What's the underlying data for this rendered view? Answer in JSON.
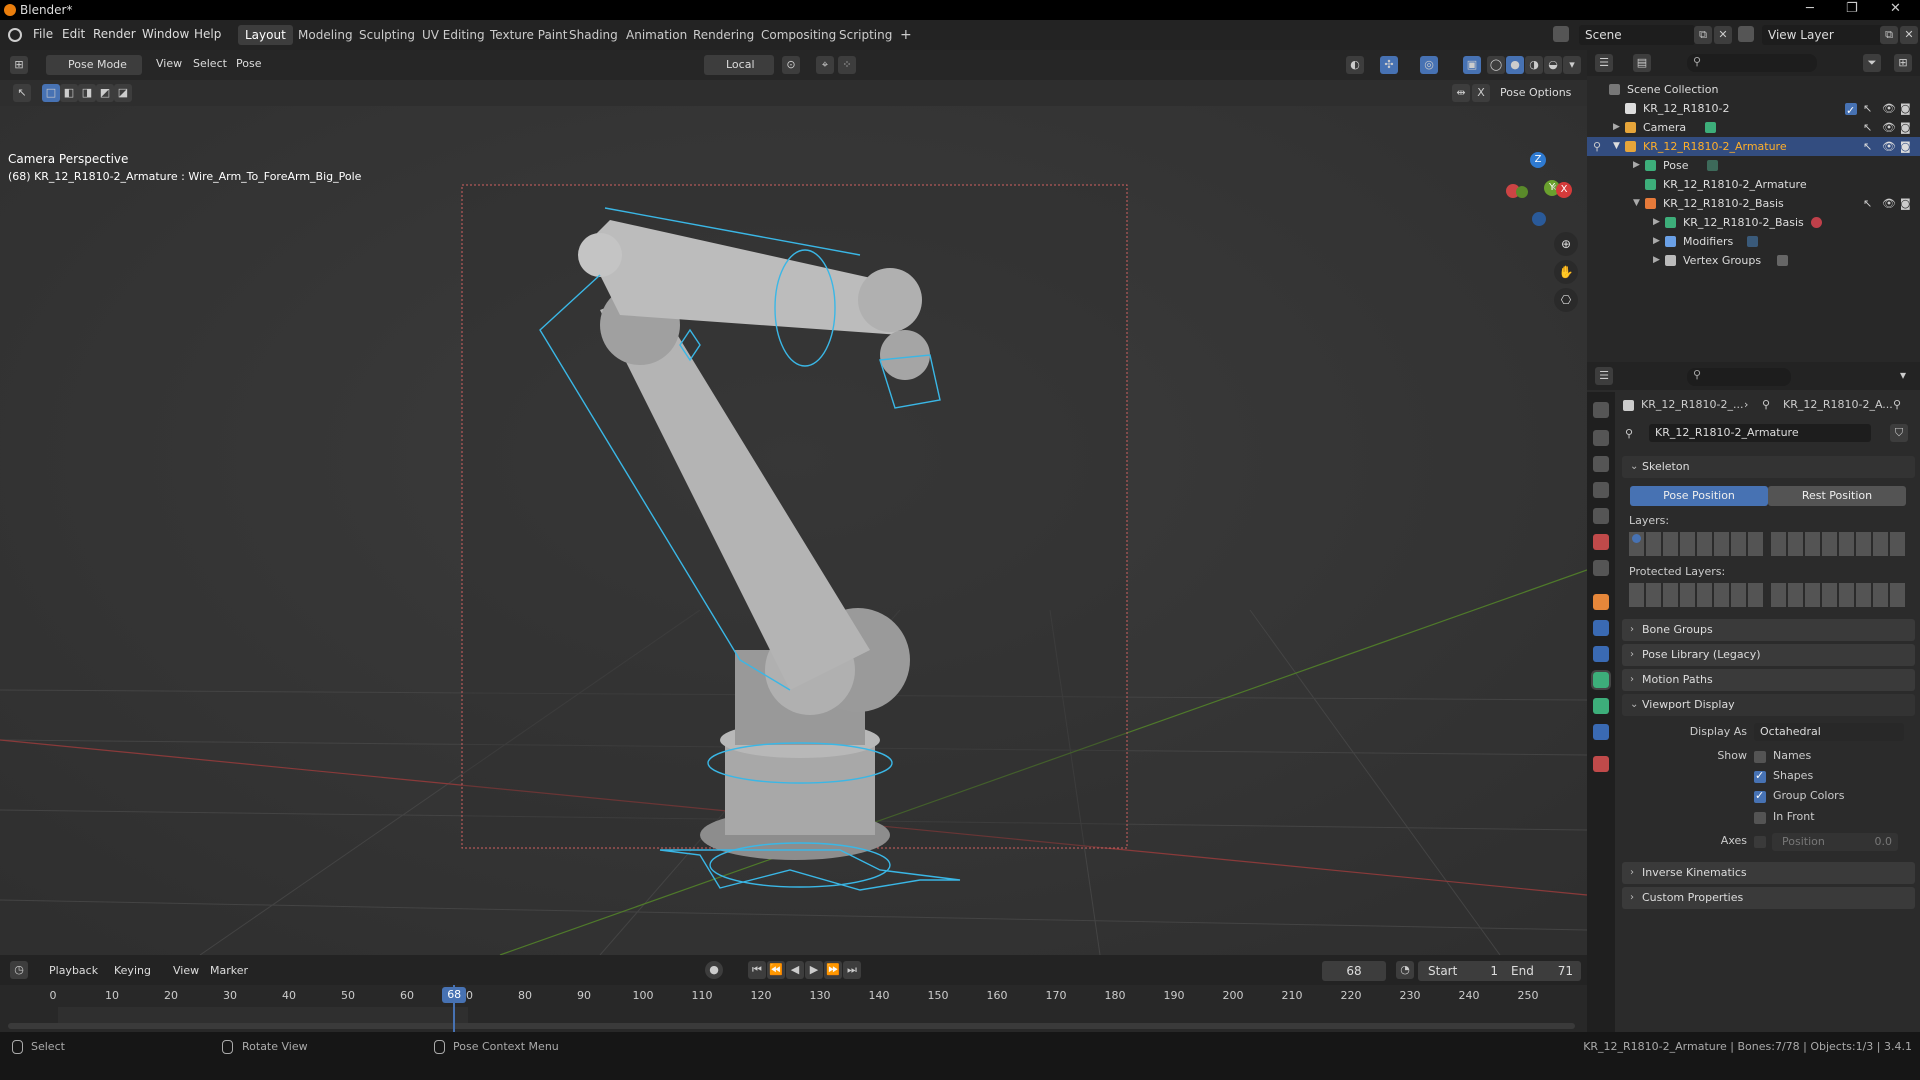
{
  "window": {
    "title": "Blender*"
  },
  "menu": [
    "File",
    "Edit",
    "Render",
    "Window",
    "Help"
  ],
  "workspaces": [
    {
      "label": "Layout",
      "active": true
    },
    {
      "label": "Modeling"
    },
    {
      "label": "Sculpting"
    },
    {
      "label": "UV Editing"
    },
    {
      "label": "Texture Paint"
    },
    {
      "label": "Shading"
    },
    {
      "label": "Animation"
    },
    {
      "label": "Rendering"
    },
    {
      "label": "Compositing"
    },
    {
      "label": "Scripting"
    }
  ],
  "add_workspace": "+",
  "scene": {
    "label": "Scene"
  },
  "view_layer": {
    "label": "View Layer"
  },
  "viewport": {
    "mode": "Pose Mode",
    "menus": [
      "View",
      "Select",
      "Pose"
    ],
    "transform_orientation": "Local",
    "pose_options": "Pose Options",
    "x_axis_label": "X",
    "info_line1": "Camera Perspective",
    "info_line2": "(68) KR_12_R1810-2_Armature : Wire_Arm_To_ForeArm_Big_Pole",
    "gizmo": {
      "z": "Z",
      "y": "Y",
      "x": "X"
    }
  },
  "outliner": {
    "search_placeholder": "",
    "rows": [
      {
        "label": "Scene Collection",
        "indent": 0,
        "color": "#cccccc"
      },
      {
        "label": "KR_12_R1810-2",
        "indent": 1,
        "color": "#e0e0e0"
      },
      {
        "label": "Camera",
        "indent": 1,
        "color": "#e6a53a"
      },
      {
        "label": "KR_12_R1810-2_Armature",
        "indent": 1,
        "color": "#e6a53a",
        "selected": true
      },
      {
        "label": "Pose",
        "indent": 2,
        "color": "#3dae7a"
      },
      {
        "label": "KR_12_R1810-2_Armature",
        "indent": 2,
        "color": "#3dae7a"
      },
      {
        "label": "KR_12_R1810-2_Basis",
        "indent": 2,
        "color": "#e67a3a"
      },
      {
        "label": "KR_12_R1810-2_Basis",
        "indent": 3,
        "color": "#3dae7a"
      },
      {
        "label": "Modifiers",
        "indent": 3,
        "color": "#6aa0e6"
      },
      {
        "label": "Vertex Groups",
        "indent": 3,
        "color": "#bbbbbb"
      }
    ]
  },
  "properties": {
    "breadcrumb_obj": "KR_12_R1810-2_...",
    "breadcrumb_data": "KR_12_R1810-2_A...",
    "datablock_name": "KR_12_R1810-2_Armature",
    "skeleton": {
      "title": "Skeleton",
      "pose_position": "Pose Position",
      "rest_position": "Rest Position",
      "layers_label": "Layers:",
      "protected_layers_label": "Protected Layers:"
    },
    "panels_collapsed_top": [
      "Bone Groups",
      "Pose Library (Legacy)",
      "Motion Paths"
    ],
    "viewport_display": {
      "title": "Viewport Display",
      "display_as_label": "Display As",
      "display_as_value": "Octahedral",
      "show_label": "Show",
      "options": [
        {
          "label": "Names",
          "checked": false
        },
        {
          "label": "Shapes",
          "checked": true
        },
        {
          "label": "Group Colors",
          "checked": true
        },
        {
          "label": "In Front",
          "checked": false
        }
      ],
      "axes_label": "Axes",
      "axes_position_label": "Position",
      "axes_position_value": "0.0"
    },
    "panels_collapsed_bottom": [
      "Inverse Kinematics",
      "Custom Properties"
    ]
  },
  "timeline": {
    "menus": [
      "Playback",
      "Keying",
      "View",
      "Marker"
    ],
    "current_frame": "68",
    "start_label": "Start",
    "start_value": "1",
    "end_label": "End",
    "end_value": "71",
    "ticks": [
      "0",
      "10",
      "20",
      "30",
      "40",
      "50",
      "60",
      "70",
      "80",
      "90",
      "100",
      "110",
      "120",
      "130",
      "140",
      "150",
      "160",
      "170",
      "180",
      "190",
      "200",
      "210",
      "220",
      "230",
      "240",
      "250"
    ]
  },
  "status": {
    "select": "Select",
    "rotate": "Rotate View",
    "context_menu": "Pose Context Menu",
    "info": "KR_12_R1810-2_Armature | Bones:7/78 | Objects:1/3 | 3.4.1"
  }
}
